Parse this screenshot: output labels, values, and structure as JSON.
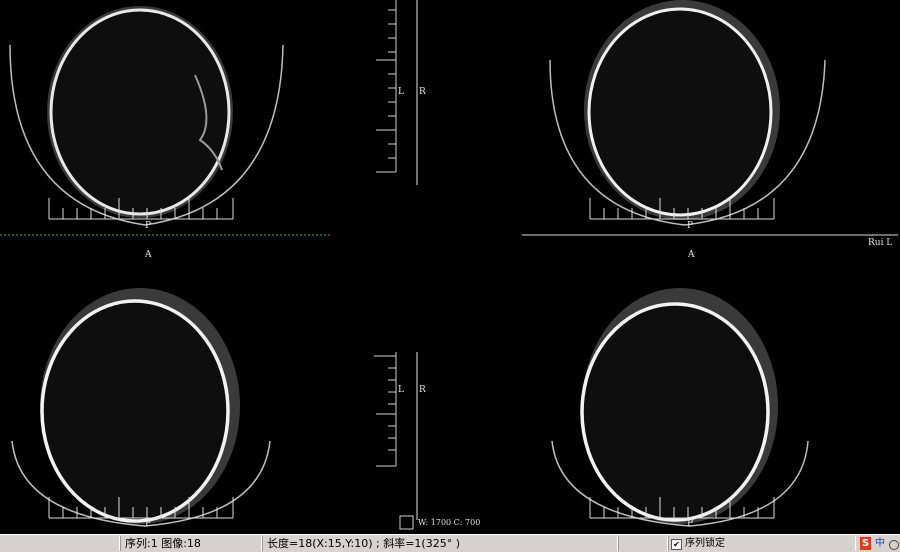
{
  "viewer": {
    "orientation": {
      "top_left_bottom": "P",
      "top_right_bottom": "P",
      "bottom_left_bottom": "P",
      "bottom_right_bottom": "P",
      "mid_left": "A",
      "mid_right": "A",
      "ruler_top_left": "L",
      "ruler_top_right": "R",
      "ruler_bottom_left": "L",
      "ruler_bottom_right": "R"
    },
    "corner_text": "Rui L",
    "window_level": "W: 1700  C: 700"
  },
  "status": {
    "series_image": "序列:1 图像:18",
    "measure": "长度=18(X:15,Y:10) ; 斜率=1(325° )",
    "lock_label": "序列锁定",
    "lock_checked": true,
    "tray": {
      "sogou": "S",
      "lang": "中"
    }
  }
}
